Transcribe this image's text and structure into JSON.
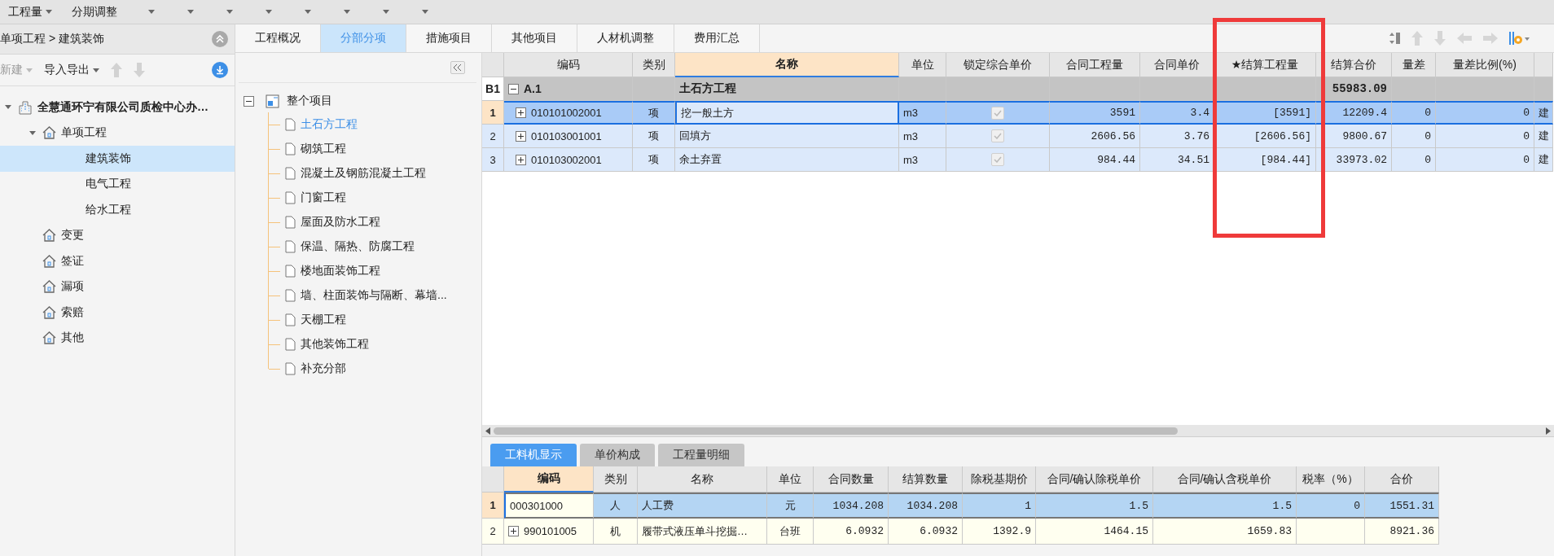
{
  "menu": [
    {
      "label": "工程量",
      "caret": true
    },
    {
      "label": "分期调整",
      "caret": false
    }
  ],
  "breadcrumb": "单项工程 > 建筑装饰",
  "left_toolbar": {
    "new": "新建",
    "import_export": "导入导出"
  },
  "project_tree": [
    {
      "label": "全慧通环宁有限公司质检中心办…",
      "kind": "building",
      "expanded": true,
      "selected": false,
      "children": [
        {
          "label": "单项工程",
          "kind": "house",
          "expanded": true,
          "selected": false,
          "children": [
            {
              "label": "建筑装饰",
              "selected": true
            },
            {
              "label": "电气工程",
              "selected": false
            },
            {
              "label": "给水工程",
              "selected": false
            }
          ]
        },
        {
          "label": "变更",
          "kind": "house",
          "selected": false
        },
        {
          "label": "签证",
          "kind": "house",
          "selected": false
        },
        {
          "label": "漏项",
          "kind": "house",
          "selected": false
        },
        {
          "label": "索赔",
          "kind": "house",
          "selected": false
        },
        {
          "label": "其他",
          "kind": "house",
          "selected": false
        }
      ]
    }
  ],
  "tabs": [
    {
      "label": "工程概况",
      "selected": false
    },
    {
      "label": "分部分项",
      "selected": true
    },
    {
      "label": "措施项目",
      "selected": false
    },
    {
      "label": "其他项目",
      "selected": false
    },
    {
      "label": "人材机调整",
      "selected": false
    },
    {
      "label": "费用汇总",
      "selected": false
    }
  ],
  "section_tree": {
    "root": "整个项目",
    "expanded": true,
    "children": [
      {
        "label": "土石方工程",
        "selected": true
      },
      {
        "label": "砌筑工程",
        "selected": false
      },
      {
        "label": "混凝土及钢筋混凝土工程",
        "selected": false
      },
      {
        "label": "门窗工程",
        "selected": false
      },
      {
        "label": "屋面及防水工程",
        "selected": false
      },
      {
        "label": "保温、隔热、防腐工程",
        "selected": false
      },
      {
        "label": "楼地面装饰工程",
        "selected": false
      },
      {
        "label": "墙、柱面装饰与隔断、幕墙...",
        "selected": false
      },
      {
        "label": "天棚工程",
        "selected": false
      },
      {
        "label": "其他装饰工程",
        "selected": false
      },
      {
        "label": "补充分部",
        "selected": false
      }
    ]
  },
  "main_grid": {
    "columns": [
      {
        "label": "编码",
        "kind": "code",
        "selected": false
      },
      {
        "label": "类别",
        "kind": "type",
        "selected": false
      },
      {
        "label": "名称",
        "kind": "name",
        "selected": true
      },
      {
        "label": "单位",
        "kind": "unit",
        "selected": false
      },
      {
        "label": "锁定综合单价",
        "kind": "check",
        "selected": false
      },
      {
        "label": "合同工程量",
        "kind": "num",
        "selected": false
      },
      {
        "label": "合同单价",
        "kind": "num",
        "selected": false
      },
      {
        "label": "★结算工程量",
        "kind": "num",
        "selected": false
      },
      {
        "label": "结算合价",
        "kind": "total",
        "selected": false
      },
      {
        "label": "量差",
        "kind": "num",
        "selected": false
      },
      {
        "label": "量差比例(%)",
        "kind": "num",
        "selected": false
      },
      {
        "kind": "text",
        "selected": false
      }
    ],
    "group_row": {
      "index": "B1",
      "code": "A.1",
      "name": "土石方工程",
      "expanded": true,
      "total": "55983.09"
    },
    "rows": [
      {
        "index": "1",
        "code": "010101002001",
        "type": "项",
        "name": "挖一般土方",
        "unit": "m3",
        "locked": true,
        "selected": true,
        "expandable": true,
        "values": [
          "3591",
          "3.4",
          "[3591]",
          "12209.4",
          "0",
          "0",
          "建"
        ]
      },
      {
        "index": "2",
        "code": "010103001001",
        "type": "项",
        "name": "回填方",
        "unit": "m3",
        "locked": true,
        "selected": false,
        "expandable": true,
        "values": [
          "2606.56",
          "3.76",
          "[2606.56]",
          "9800.67",
          "0",
          "0",
          "建"
        ]
      },
      {
        "index": "3",
        "code": "010103002001",
        "type": "项",
        "name": "余土弃置",
        "unit": "m3",
        "locked": true,
        "selected": false,
        "expandable": true,
        "values": [
          "984.44",
          "34.51",
          "[984.44]",
          "33973.02",
          "0",
          "0",
          "建"
        ]
      }
    ]
  },
  "bottom_tabs": [
    {
      "label": "工料机显示",
      "selected": true
    },
    {
      "label": "单价构成",
      "selected": false
    },
    {
      "label": "工程量明细",
      "selected": false
    }
  ],
  "detail_grid": {
    "columns": [
      {
        "label": "编码",
        "kind": "code",
        "selected": true
      },
      {
        "label": "类别",
        "kind": "center",
        "selected": false
      },
      {
        "label": "名称",
        "kind": "text",
        "selected": false
      },
      {
        "label": "单位",
        "kind": "center",
        "selected": false
      },
      {
        "label": "合同数量",
        "kind": "num",
        "selected": false
      },
      {
        "label": "结算数量",
        "kind": "num",
        "selected": false
      },
      {
        "label": "除税基期价",
        "kind": "num",
        "selected": false
      },
      {
        "label": "合同/确认除税单价",
        "kind": "num",
        "selected": false
      },
      {
        "label": "合同/确认含税单价",
        "kind": "num",
        "selected": false
      },
      {
        "label": "税率（%）",
        "kind": "num",
        "selected": false
      },
      {
        "label": "合价",
        "kind": "num",
        "selected": false
      }
    ],
    "rows": [
      {
        "index": "1",
        "expandable": false,
        "selected": true,
        "cells": [
          "000301000",
          "人",
          "人工费",
          "元",
          "1034.208",
          "1034.208",
          "1",
          "1.5",
          "1.5",
          "0",
          "1551.31"
        ]
      },
      {
        "index": "2",
        "expandable": true,
        "selected": false,
        "cells": [
          "990101005",
          "机",
          "履带式液压单斗挖掘…",
          "台班",
          "6.0932",
          "6.0932",
          "1392.9",
          "1464.15",
          "1659.83",
          "",
          "8921.36"
        ]
      }
    ]
  }
}
